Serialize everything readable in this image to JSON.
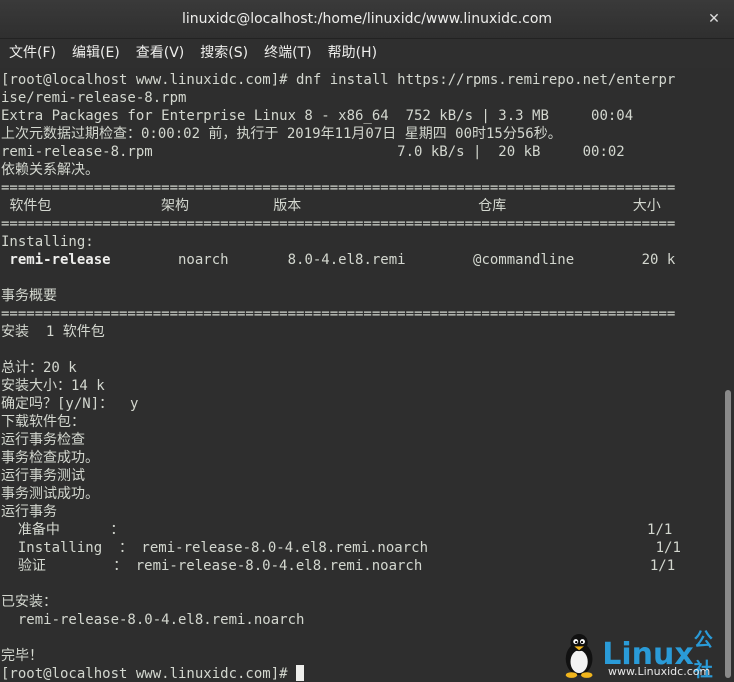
{
  "window": {
    "title": "linuxidc@localhost:/home/linuxidc/www.linuxidc.com",
    "close_glyph": "✕"
  },
  "menu": [
    {
      "label": "文件(F)"
    },
    {
      "label": "编辑(E)"
    },
    {
      "label": "查看(V)"
    },
    {
      "label": "搜索(S)"
    },
    {
      "label": "终端(T)"
    },
    {
      "label": "帮助(H)"
    }
  ],
  "terminal": {
    "lines": [
      "[root@localhost www.linuxidc.com]# dnf install https://rpms.remirepo.net/enterpr",
      "ise/remi-release-8.rpm",
      "Extra Packages for Enterprise Linux 8 - x86_64  752 kB/s | 3.3 MB     00:04",
      "上次元数据过期检查：0:00:02 前，执行于 2019年11月07日 星期四 00时15分56秒。",
      "remi-release-8.rpm                             7.0 kB/s |  20 kB     00:02",
      "依赖关系解决。",
      "================================================================================",
      " 软件包             架构          版本                     仓库               大小",
      "================================================================================",
      "Installing:",
      " remi-release        noarch       8.0-4.el8.remi        @commandline        20 k",
      "",
      "事务概要",
      "================================================================================",
      "安装  1 软件包",
      "",
      "总计：20 k",
      "安装大小：14 k",
      "确定吗？[y/N]：  y",
      "下载软件包：",
      "运行事务检查",
      "事务检查成功。",
      "运行事务测试",
      "事务测试成功。",
      "运行事务",
      "  准备中      ：                                                              1/1",
      "  Installing  ： remi-release-8.0-4.el8.remi.noarch                           1/1",
      "  验证        ： remi-release-8.0-4.el8.remi.noarch                           1/1",
      "",
      "已安装：",
      "  remi-release-8.0-4.el8.remi.noarch",
      "",
      "完毕！",
      "[root@localhost www.linuxidc.com]# "
    ],
    "bold_package": "remi-release"
  },
  "watermark": {
    "brand": "Linux",
    "brand_cn": "公社",
    "url": "www.Linuxidc.com",
    "color": "#2a9bd8"
  }
}
